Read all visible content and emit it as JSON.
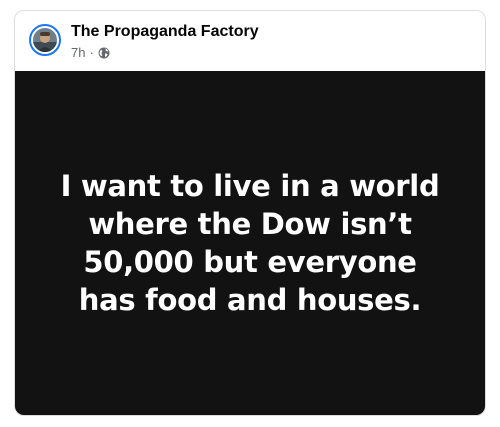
{
  "post": {
    "page_name": "The Propaganda Factory",
    "time_ago": "7h",
    "separator": "·",
    "audience_icon": "globe-icon",
    "image_text_lines": [
      "I want to live in a world",
      "where the Dow isn’t",
      "50,000 but everyone",
      "has food and houses."
    ]
  },
  "colors": {
    "image_background": "#121212",
    "avatar_ring": "#1877f2",
    "meta_text": "#65676b"
  }
}
